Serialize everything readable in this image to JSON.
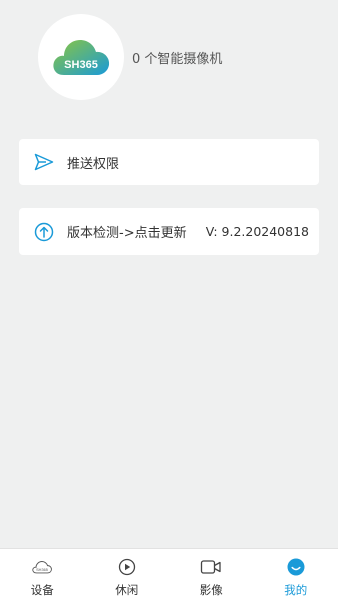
{
  "profile": {
    "logo_text": "SH365",
    "camera_count_text": "0 个智能摄像机"
  },
  "menu": {
    "push_permission_label": "推送权限",
    "version_check_label": "版本检测->点击更新",
    "version_value": "V: 9.2.20240818"
  },
  "tabbar": {
    "tabs": [
      {
        "label": "设备",
        "icon": "cloud-sh365-icon",
        "active": false
      },
      {
        "label": "休闲",
        "icon": "play-circle-icon",
        "active": false
      },
      {
        "label": "影像",
        "icon": "video-camera-icon",
        "active": false
      },
      {
        "label": "我的",
        "icon": "profile-smile-icon",
        "active": true
      }
    ]
  },
  "colors": {
    "background": "#eff0f0",
    "accent": "#1a9ad8",
    "logo_gradient_start": "#8cc63f",
    "logo_gradient_end": "#1a9ad8"
  }
}
